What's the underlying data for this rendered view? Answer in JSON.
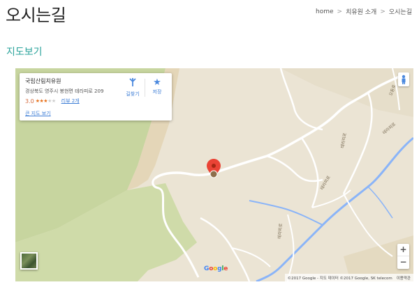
{
  "page": {
    "title": "오시는길",
    "section_title": "지도보기"
  },
  "breadcrumb": {
    "items": [
      "home",
      "치유원 소개",
      "오시는길"
    ]
  },
  "map": {
    "info_card": {
      "place_name": "국립산림치유원",
      "address": "경상북도 영주시 봉현면 테라피로 209",
      "rating": "3.0",
      "stars_filled": 3,
      "stars_total": 5,
      "reviews": "리뷰 2개",
      "larger_map_link": "큰 지도 보기",
      "directions_label": "길찾기",
      "save_label": "저장"
    },
    "road_labels": [
      "오동로",
      "테라피로",
      "테라피로",
      "테라피로",
      "테라피로"
    ],
    "zoom_in": "+",
    "zoom_out": "−",
    "google_logo": "Google",
    "attribution": "©2017 Google - 지도 데이터 ©2017 Google, SK telecom",
    "terms_link": "이용약관",
    "colors": {
      "land": "#ebe4d4",
      "forest": "#c3d39c",
      "water": "#8ab4f8",
      "road": "#ffffff",
      "accent": "#2aa39b",
      "marker": "#ea4335"
    }
  }
}
